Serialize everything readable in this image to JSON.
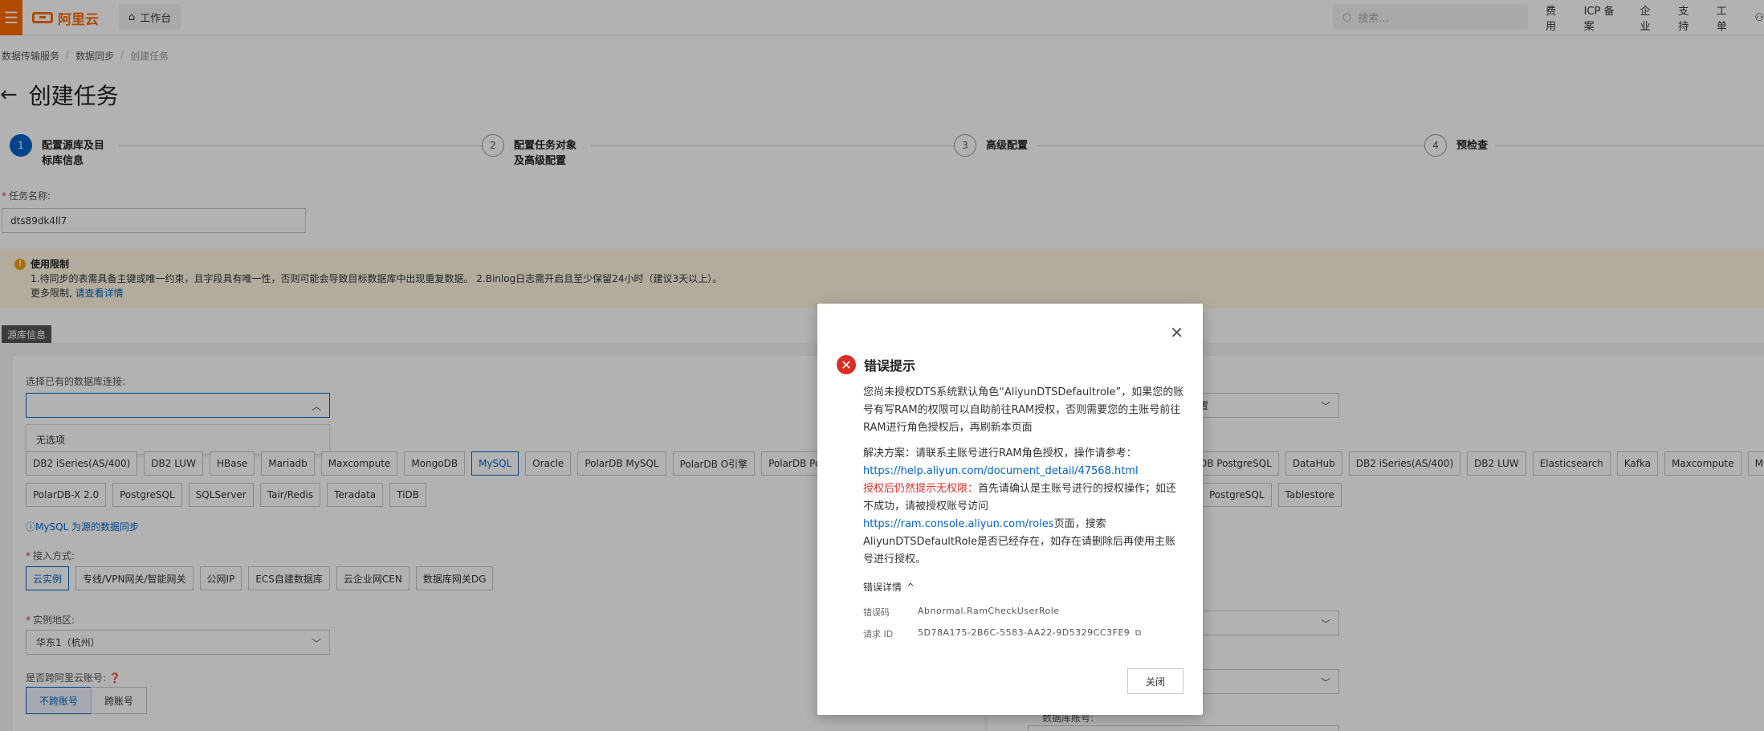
{
  "topbar": {
    "menu_icon": "menu-icon",
    "logo_text": "阿里云",
    "workbench_label": "工作台",
    "search_placeholder": "搜索...",
    "nav": [
      "费用",
      "ICP 备案",
      "企业",
      "支持",
      "工单"
    ]
  },
  "breadcrumb": [
    "数据传输服务",
    "数据同步",
    "创建任务"
  ],
  "page_title": "创建任务",
  "steps": [
    {
      "num": "1",
      "label_line1": "配置源库及目",
      "label_line2": "标库信息"
    },
    {
      "num": "2",
      "label_line1": "配置任务对象",
      "label_line2": "及高级配置"
    },
    {
      "num": "3",
      "label_line1": "高级配置",
      "label_line2": ""
    },
    {
      "num": "4",
      "label_line1": "预检查",
      "label_line2": ""
    }
  ],
  "task_name": {
    "label": "任务名称:",
    "value": "dts89dk4ll7"
  },
  "notice": {
    "title": "使用限制",
    "line1": "1.待同步的表需具备主键或唯一约束，且字段具有唯一性，否则可能会导致目标数据库中出现重复数据。 2.Binlog日志需开启且至少保留24小时（建议3天以上）。",
    "more_prefix": "更多限制,",
    "more_link": "请查看详情"
  },
  "source": {
    "tag": "源库信息",
    "conn_label": "选择已有的数据库连接:",
    "conn_value": "",
    "dropdown_option": "无选项",
    "db_types_row1": [
      "DB2 iSeries(AS/400)",
      "DB2 LUW",
      "HBase",
      "Mariadb",
      "Maxcompute",
      "MongoDB",
      "MySQL",
      "Oracle",
      "PolarDB MySQL",
      "PolarDB O引擎",
      "PolarDB Postgre"
    ],
    "db_types_row2": [
      "PolarDB-X 2.0",
      "PostgreSQL",
      "SQLServer",
      "Tair/Redis",
      "Teradata",
      "TiDB"
    ],
    "selected_db": "MySQL",
    "help_link": "ⓘMySQL 为源的数据同步",
    "access_label": "接入方式:",
    "access_options": [
      "云实例",
      "专线/VPN网关/智能网关",
      "公网IP",
      "ECS自建数据库",
      "云企业网CEN",
      "数据库网关DG"
    ],
    "region_label": "实例地区:",
    "region_value": "华东1（杭州）",
    "cross_label": "是否跨阿里云账号:",
    "cross_options": [
      "不跨账号",
      "跨账号"
    ]
  },
  "target": {
    "select1_value": "置",
    "db_types_row1": [
      "DB PostgreSQL",
      "DataHub",
      "DB2 iSeries(AS/400)",
      "DB2 LUW",
      "Elasticsearch",
      "Kafka",
      "Maxcompute",
      "MySQ"
    ],
    "db_types_row2": [
      "PostgreSQL",
      "Tablestore"
    ],
    "account_label": "数据库账号:"
  },
  "modal": {
    "title": "错误提示",
    "para1": "您尚未授权DTS系统默认角色“AliyunDTSDefaultrole”，如果您的账号有写RAM的权限可以自助前往RAM授权，否则需要您的主账号前往RAM进行角色授权后，再刷新本页面",
    "solution_prefix": "解决方案：请联系主账号进行RAM角色授权，操作请参考：",
    "solution_link": "https://help.aliyun.com/document_detail/47568.html",
    "still_red": "授权后仍然提示无权限：",
    "still_text": "首先请确认是主账号进行的授权操作；如还不成功，请被授权账号访问",
    "roles_link": "https://ram.console.aliyun.com/roles",
    "roles_suffix": "页面，搜索AliyunDTSDefaultRole是否已经存在，如存在请删除后再使用主账号进行授权。",
    "details_label": "错误详情",
    "error_code_label": "错误码",
    "error_code": "Abnormal.RamCheckUserRole",
    "request_id_label": "请求 ID",
    "request_id": "5D78A175-2B6C-5583-AA22-9D5329CC3FE9",
    "close_button": "关闭"
  }
}
